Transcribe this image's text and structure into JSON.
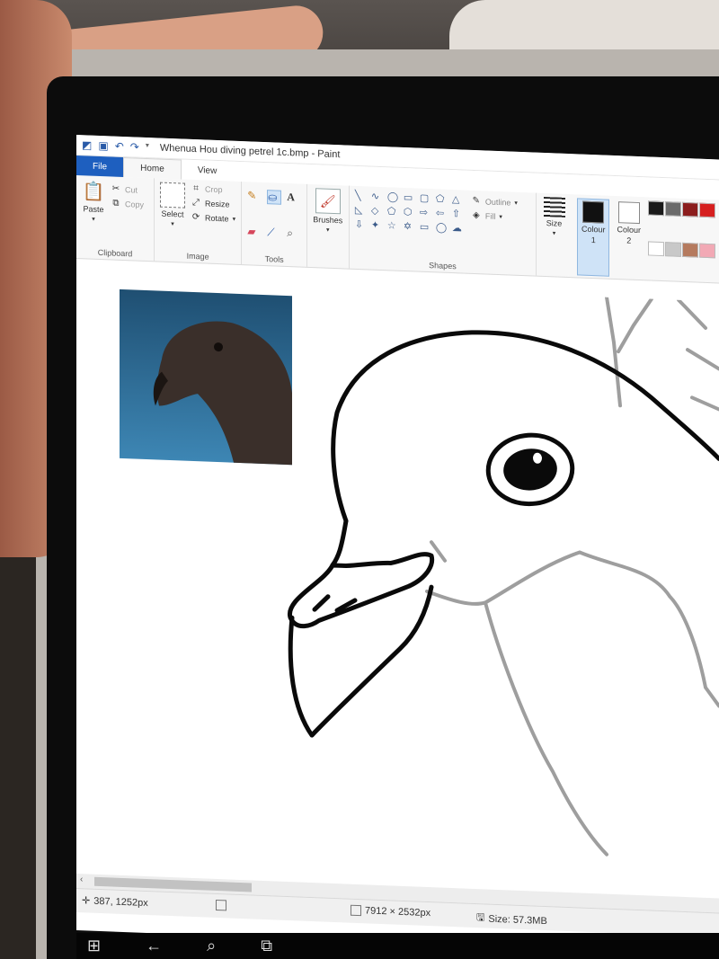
{
  "window": {
    "title": "Whenua Hou diving petrel 1c.bmp - Paint"
  },
  "tabs": {
    "file": "File",
    "home": "Home",
    "view": "View"
  },
  "ribbon": {
    "clipboard": {
      "paste": "Paste",
      "cut": "Cut",
      "copy": "Copy",
      "label": "Clipboard"
    },
    "image": {
      "select": "Select",
      "crop": "Crop",
      "resize": "Resize",
      "rotate": "Rotate",
      "label": "Image"
    },
    "tools": {
      "label": "Tools"
    },
    "brushes": {
      "label": "Brushes"
    },
    "shapes": {
      "outline": "Outline",
      "fill": "Fill",
      "size": "Size",
      "label": "Shapes"
    },
    "colours": {
      "colour1": "Colour",
      "colour1_num": "1",
      "colour2": "Colour",
      "colour2_num": "2",
      "colour1_value": "#111111",
      "colour2_value": "#ffffff",
      "palette": [
        "#1a1a1a",
        "#6b6b6b",
        "#8c1d1d",
        "#d61f1f",
        "#ffffff",
        "#c8c8c8",
        "#b57a5e",
        "#f2a9b5"
      ]
    }
  },
  "status": {
    "cursor": "387, 1252px",
    "dimensions": "7912 × 2532px",
    "size": "Size: 57.3MB"
  },
  "icons": {
    "qat": [
      "paint-app-icon",
      "save-icon",
      "undo-icon",
      "redo-icon",
      "customize-icon"
    ]
  }
}
